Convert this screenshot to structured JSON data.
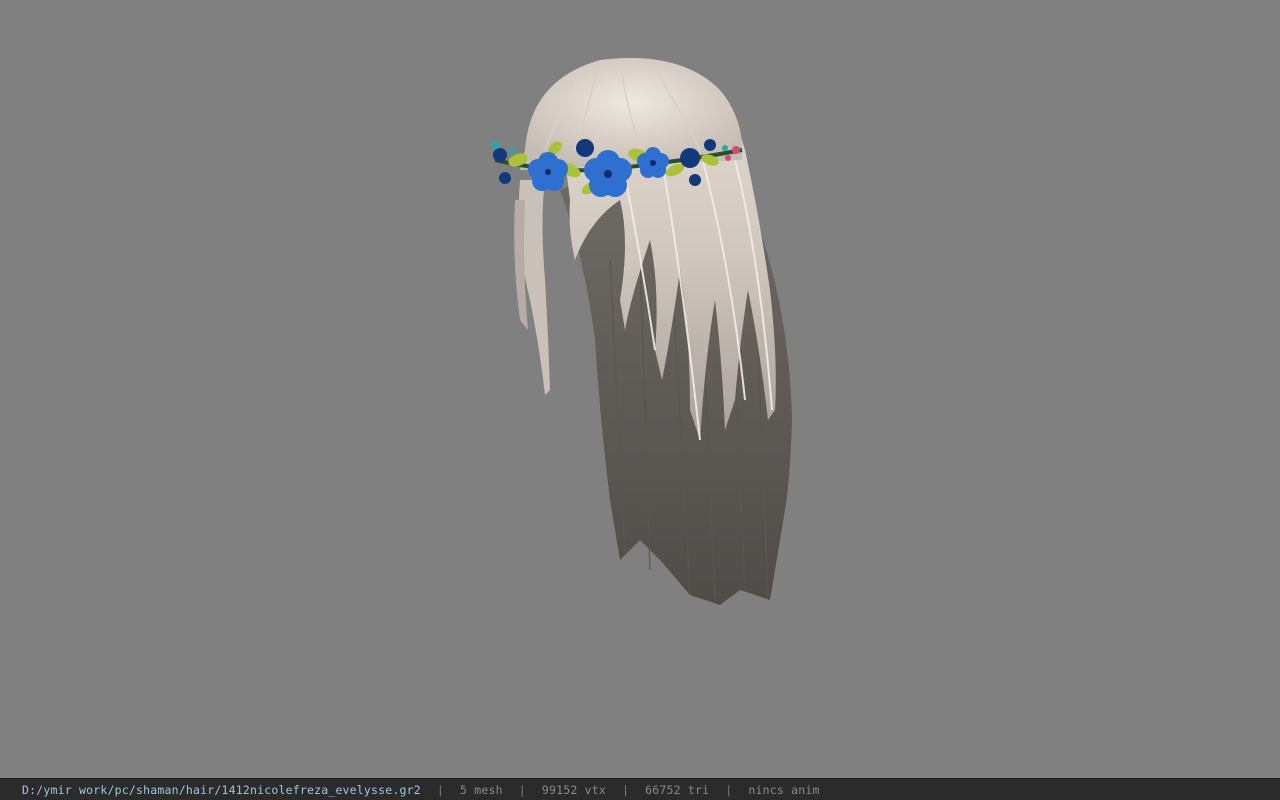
{
  "viewer": {
    "background_color": "#808080",
    "model_icon": "hair-model-icon",
    "accent_colors": {
      "hair_light": "#d8d0c8",
      "hair_shadow": "#5e5a56",
      "flower_blue": "#2f6fd0",
      "flower_dark": "#123a7a",
      "leaf_green": "#a8c23a",
      "berry_pink": "#d04a7a"
    }
  },
  "status": {
    "file_path": "D:/ymir work/pc/shaman/hair/1412nicolefreza_evelysse.gr2",
    "separator": "|",
    "mesh_count": "5 mesh",
    "vertex_count": "99152 vtx",
    "triangle_count": "66752 tri",
    "anim": "nincs anim"
  }
}
